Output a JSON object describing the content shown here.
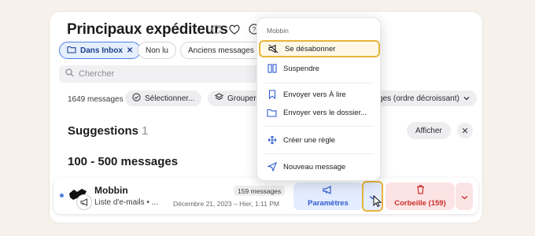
{
  "header": {
    "title": "Principaux expéditeurs",
    "icons": [
      "refresh-icon",
      "heart-icon",
      "help-icon"
    ]
  },
  "filters": [
    {
      "label": "Dans Inbox",
      "active": true,
      "icon": "folder-icon",
      "close": "✕"
    },
    {
      "label": "Non lu",
      "active": false
    },
    {
      "label": "Anciens messages",
      "active": false
    }
  ],
  "search": {
    "placeholder": "Chercher"
  },
  "toolbar": {
    "count": "1649 messages",
    "select_label": "Sélectionner...",
    "group_label": "Grouper",
    "sort_label": "ges (ordre décroissant)"
  },
  "suggestions": {
    "title": "Suggestions",
    "count": "1",
    "show_label": "Afficher",
    "dismiss": "✕"
  },
  "range_title": "100 - 500 messages",
  "sender_row": {
    "name": "Mobbin",
    "subtitle": "Liste d'e-mails • ...",
    "badge": "159 messages",
    "dates": "Décembre 21, 2023 – Hier, 1:11 PM",
    "settings_label": "Paramètres",
    "trash_label": "Corbeille (159)"
  },
  "menu": {
    "header": "Mobbin",
    "items": [
      {
        "label": "Se désabonner",
        "icon": "unsubscribe-megaphone-icon",
        "highlight": true
      },
      {
        "label": "Suspendre",
        "icon": "pause-icon"
      },
      {
        "label": "Envoyer vers À lire",
        "icon": "bookmark-icon"
      },
      {
        "label": "Envoyer vers le dossier...",
        "icon": "folder-icon"
      },
      {
        "label": "Créer une règle",
        "icon": "rule-arrows-icon"
      },
      {
        "label": "Nouveau message",
        "icon": "send-icon"
      }
    ]
  },
  "colors": {
    "accent_blue": "#4f7fe0",
    "highlight_outline": "#e7b53a",
    "danger": "#c9302c"
  }
}
